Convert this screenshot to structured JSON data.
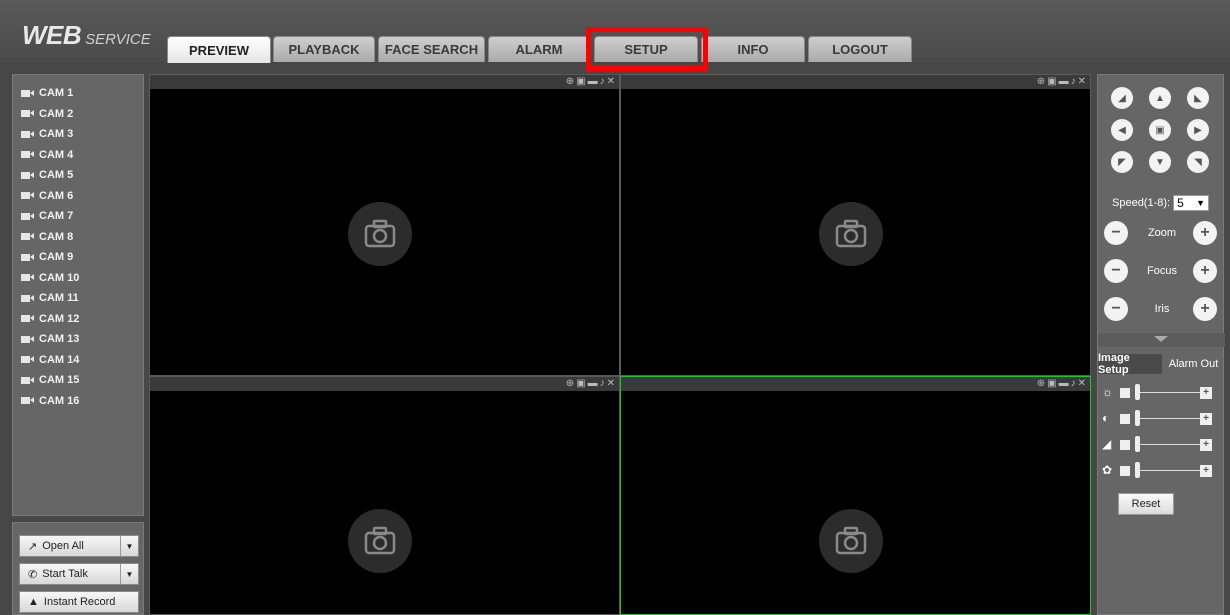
{
  "header": {
    "logo_main": "WEB",
    "logo_sub": "SERVICE",
    "tabs": [
      "PREVIEW",
      "PLAYBACK",
      "FACE SEARCH",
      "ALARM",
      "SETUP",
      "INFO",
      "LOGOUT"
    ],
    "active_tab": "PREVIEW",
    "highlighted_tab": "SETUP",
    "highlight_color": "#ff0000"
  },
  "cameras": [
    "CAM 1",
    "CAM 2",
    "CAM 3",
    "CAM 4",
    "CAM 5",
    "CAM 6",
    "CAM 7",
    "CAM 8",
    "CAM 9",
    "CAM 10",
    "CAM 11",
    "CAM 12",
    "CAM 13",
    "CAM 14",
    "CAM 15",
    "CAM 16"
  ],
  "actions": {
    "open_all": "Open All",
    "start_talk": "Start Talk",
    "instant_record": "Instant Record"
  },
  "video": {
    "pane_count": 4,
    "selected_pane": 4,
    "selected_color": "#22c22e",
    "pane_controls": [
      "zoom-icon",
      "snapshot-icon",
      "record-icon",
      "audio-icon",
      "close-icon"
    ]
  },
  "ptz": {
    "speed_label": "Speed(1-8):",
    "speed_value": "5",
    "zoom_label": "Zoom",
    "focus_label": "Focus",
    "iris_label": "Iris"
  },
  "image_setup": {
    "tab_image": "Image Setup",
    "tab_alarm": "Alarm Out",
    "sliders": [
      "brightness-icon",
      "contrast-icon",
      "saturation-icon",
      "hue-icon"
    ],
    "reset_label": "Reset"
  }
}
